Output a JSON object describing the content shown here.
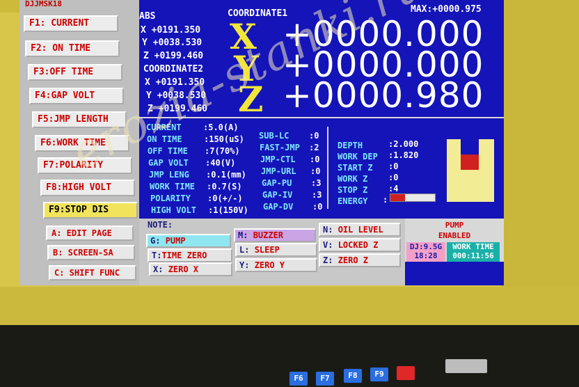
{
  "app_title": "DJJMSK18",
  "function_keys": [
    {
      "label": "F1: CURRENT"
    },
    {
      "label": "F2: ON TIME"
    },
    {
      "label": "F3:OFF TIME"
    },
    {
      "label": "F4:GAP VOLT"
    },
    {
      "label": "F5:JMP LENGTH"
    },
    {
      "label": "F6:WORK TIME"
    },
    {
      "label": "F7:POLARITY"
    },
    {
      "label": "F8:HIGH VOLT"
    },
    {
      "label": "F9:STOP DIS"
    }
  ],
  "sub_keys": [
    {
      "label": "A: EDIT PAGE"
    },
    {
      "label": "B: SCREEN-SA"
    },
    {
      "label": "C: SHIFT FUNC"
    }
  ],
  "abs": {
    "title": "ABS",
    "x": "X +0191.350",
    "y": "Y +0038.530",
    "z": "Z +0199.460"
  },
  "coord2": {
    "title": "COORDINATE2",
    "x": "X +0191.350",
    "y": "Y +0038.530",
    "z": "Z +0199.460"
  },
  "coord1": {
    "title": "COORDINATE1",
    "max": "MAX:+0000.975",
    "x_axis": "X",
    "x_val": "+0000.000",
    "y_axis": "Y",
    "y_val": "+0000.000",
    "z_axis": "Z",
    "z_val": "+0000.980"
  },
  "params": [
    {
      "label": "CURRENT",
      "value": ":5.0(A)"
    },
    {
      "label": "ON TIME",
      "value": ":150(uS)"
    },
    {
      "label": "OFF TIME",
      "value": ":7(70%)"
    },
    {
      "label": "GAP VOLT",
      "value": ":40(V)"
    },
    {
      "label": "JMP LENG",
      "value": ":0.1(mm)"
    },
    {
      "label": "WORK TIME",
      "value": ":0.7(S)"
    },
    {
      "label": "POLARITY",
      "value": ":0(+/-)"
    },
    {
      "label": "HIGH VOLT",
      "value": ":1(150V)"
    }
  ],
  "subs": [
    {
      "label": "SUB-LC",
      "value": ":0"
    },
    {
      "label": "FAST-JMP",
      "value": ":2"
    },
    {
      "label": "JMP-CTL",
      "value": ":0"
    },
    {
      "label": "JMP-URL",
      "value": ":0"
    },
    {
      "label": "GAP-PU",
      "value": ":3"
    },
    {
      "label": "GAP-IV",
      "value": ":3"
    },
    {
      "label": "GAP-DV",
      "value": ":0"
    }
  ],
  "status": [
    {
      "label": "DEPTH",
      "value": ":2.000"
    },
    {
      "label": "WORK DEP",
      "value": ":1.820"
    },
    {
      "label": "START Z",
      "value": ":0"
    },
    {
      "label": "WORK Z",
      "value": ":0"
    },
    {
      "label": "STOP Z",
      "value": ":4"
    },
    {
      "label": "ENERGY",
      "value": ":"
    }
  ],
  "energy_fraction": 0.33,
  "depth_fraction": 0.91,
  "note_label": "NOTE:",
  "buttons": {
    "g": {
      "key": "G:",
      "label": "PUMP"
    },
    "m": {
      "key": "M:",
      "label": "BUZZER"
    },
    "n": {
      "key": "N:",
      "label": "OIL LEVEL"
    },
    "t": {
      "key": "T:",
      "label": "TIME ZERO"
    },
    "l": {
      "key": "L:",
      "label": "SLEEP"
    },
    "v": {
      "key": "V:",
      "label": "LOCKED Z"
    },
    "x": {
      "key": "X:",
      "label": "ZERO X"
    },
    "y": {
      "key": "Y:",
      "label": "ZERO Y"
    },
    "z": {
      "key": "Z:",
      "label": "ZERO Z"
    }
  },
  "pump": {
    "line1": "PUMP",
    "line2": "ENABLED"
  },
  "dj": {
    "line1": "DJ:9.5G",
    "line2": "18:28"
  },
  "work_time": {
    "line1": "WORK TIME",
    "line2": "000:11:56"
  },
  "watermark": "erozia-stanki.ru",
  "keyboard": [
    "F6",
    "F7",
    "F8",
    "F9"
  ]
}
